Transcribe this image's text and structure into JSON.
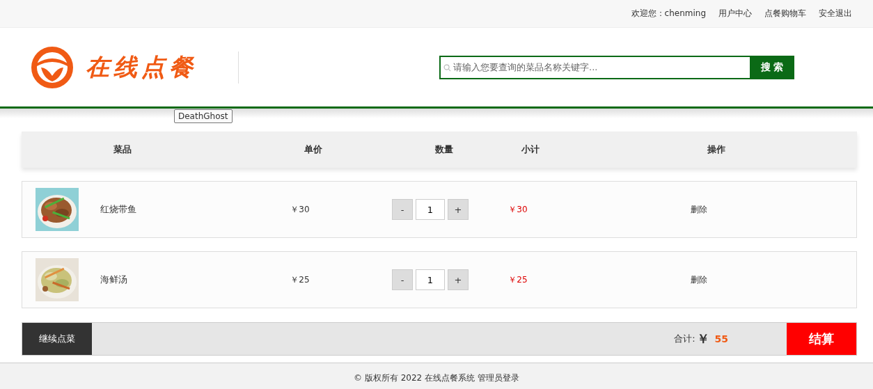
{
  "top_bar": {
    "welcome": "欢迎您：chenming",
    "links": [
      "用户中心",
      "点餐购物车",
      "安全退出"
    ]
  },
  "header": {
    "logo_text": "在线点餐",
    "search": {
      "placeholder": "请输入您要查询的菜品名称关键字...",
      "button": "搜 索"
    },
    "tooltip": "DeathGhost"
  },
  "cart": {
    "columns": [
      "菜品",
      "单价",
      "数量",
      "小计",
      "操作"
    ],
    "rows": [
      {
        "name": "红烧带鱼",
        "price": "￥30",
        "minus": "-",
        "quantity": "1",
        "plus": "+",
        "subtotal": "￥30",
        "action": "删除"
      },
      {
        "name": "海鲜汤",
        "price": "￥25",
        "minus": "-",
        "quantity": "1",
        "plus": "+",
        "subtotal": "￥25",
        "action": "删除"
      }
    ],
    "continue": "继续点菜",
    "total_label": "合计:",
    "currency": "￥",
    "total": "55",
    "checkout": "结算"
  },
  "footer": {
    "copyright": "© 版权所有 2022 在线点餐系统",
    "admin_link": "管理员登录"
  }
}
